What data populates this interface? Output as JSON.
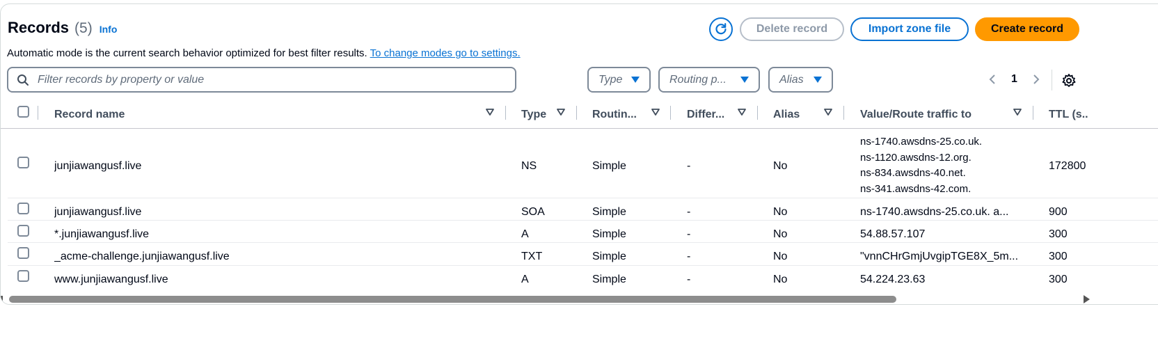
{
  "header": {
    "title": "Records",
    "count": "(5)",
    "info_label": "Info",
    "description": "Automatic mode is the current search behavior optimized for best filter results.",
    "settings_link": "To change modes go to settings."
  },
  "actions": {
    "refresh_icon": "refresh-icon",
    "delete_label": "Delete record",
    "import_label": "Import zone file",
    "create_label": "Create record"
  },
  "filters": {
    "search_placeholder": "Filter records by property or value",
    "type_label": "Type",
    "routing_label": "Routing p...",
    "alias_label": "Alias"
  },
  "pagination": {
    "current_page": "1"
  },
  "colors": {
    "accent": "#0972d3",
    "primary_button": "#ff9900"
  },
  "table": {
    "columns": [
      "Record name",
      "Type",
      "Routin...",
      "Differ...",
      "Alias",
      "Value/Route traffic to",
      "TTL (s..."
    ],
    "rows": [
      {
        "name": "junjiawangusf.live",
        "type": "NS",
        "routing": "Simple",
        "differ": "-",
        "alias": "No",
        "value": [
          "ns-1740.awsdns-25.co.uk.",
          "ns-1120.awsdns-12.org.",
          "ns-834.awsdns-40.net.",
          "ns-341.awsdns-42.com."
        ],
        "ttl": "172800"
      },
      {
        "name": "junjiawangusf.live",
        "type": "SOA",
        "routing": "Simple",
        "differ": "-",
        "alias": "No",
        "value": "ns-1740.awsdns-25.co.uk. a...",
        "ttl": "900"
      },
      {
        "name": "*.junjiawangusf.live",
        "type": "A",
        "routing": "Simple",
        "differ": "-",
        "alias": "No",
        "value": "54.88.57.107",
        "ttl": "300"
      },
      {
        "name": "_acme-challenge.junjiawangusf.live",
        "type": "TXT",
        "routing": "Simple",
        "differ": "-",
        "alias": "No",
        "value": "\"vnnCHrGmjUvgipTGE8X_5m...",
        "ttl": "300"
      },
      {
        "name": "www.junjiawangusf.live",
        "type": "A",
        "routing": "Simple",
        "differ": "-",
        "alias": "No",
        "value": "54.224.23.63",
        "ttl": "300"
      }
    ]
  }
}
